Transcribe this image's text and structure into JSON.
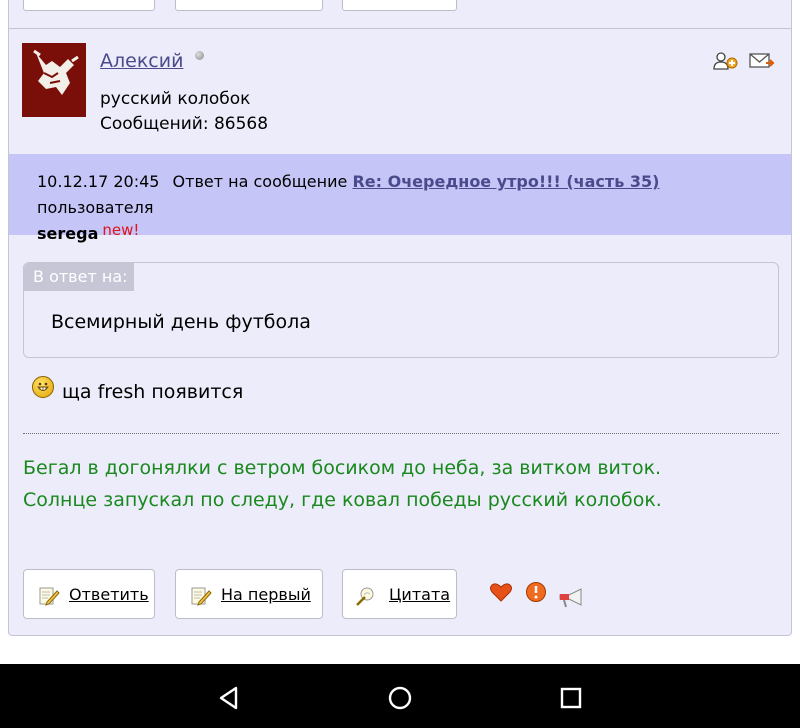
{
  "author": {
    "name": "Алексий",
    "subtitle": "русский колобок",
    "posts": "Сообщений: 86568"
  },
  "reply": {
    "timestamp": "10.12.17 20:45",
    "prefix": "Ответ на сообщение",
    "link": "Re: Очередное утро!!! (часть 35)",
    "suffix": "пользователя",
    "user": "serega",
    "new_tag": "new!"
  },
  "quote": {
    "label": "В ответ на:",
    "text": "Всемирный день футбола"
  },
  "body": {
    "text": "ща fresh появится"
  },
  "signature": [
    "Бегал в догонялки с ветром босиком до неба, за витком виток.",
    "Солнце запускал по следу, где ковал победы русский колобок."
  ],
  "actions": {
    "reply": "Ответить",
    "first": "На первый",
    "quote": "Цитата"
  },
  "colors": {
    "card_bg": "#ececfa",
    "reply_bar_bg": "#c5c5f7",
    "link": "#4a4a8c",
    "new_tag": "#e0121c",
    "signature": "#19891d"
  },
  "icons": {
    "add_friend": "add-user-icon",
    "message": "envelope-icon",
    "like": "heart-icon",
    "warn": "warning-icon",
    "report": "megaphone-icon",
    "back": "back-triangle-icon",
    "home": "home-circle-icon",
    "recents": "recents-square-icon"
  }
}
